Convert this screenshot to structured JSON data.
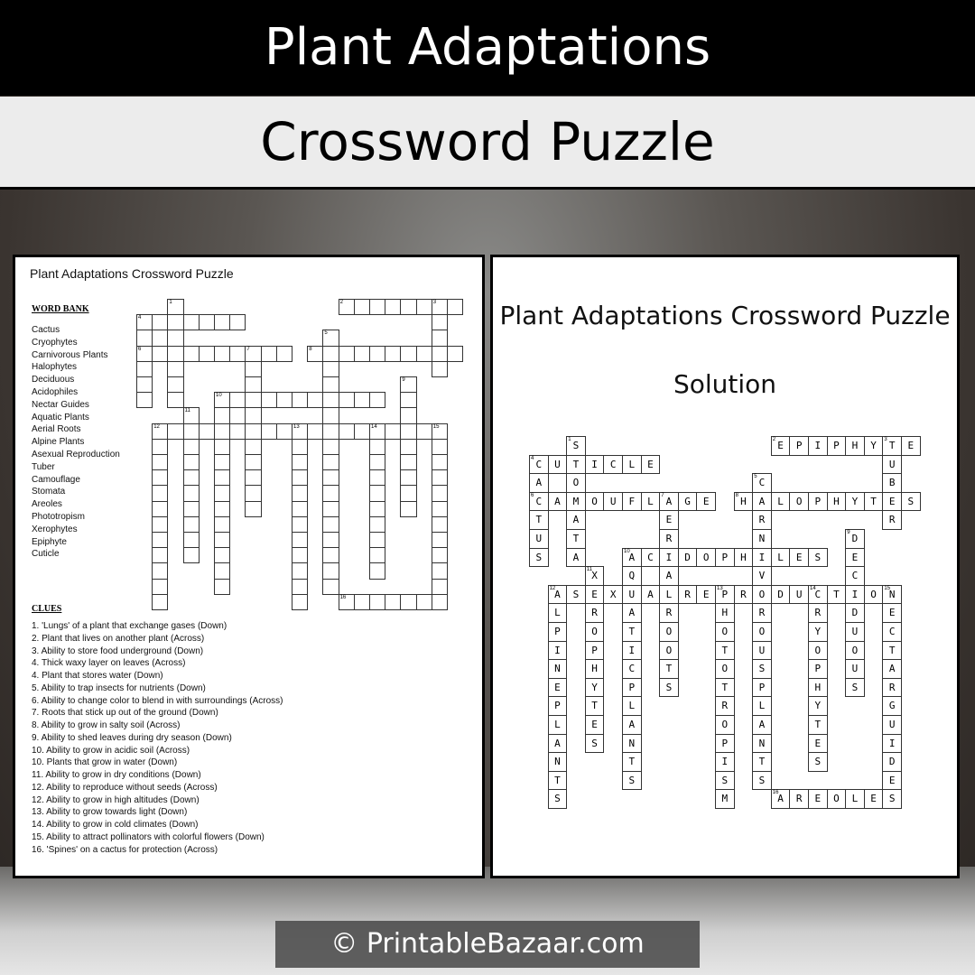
{
  "header": {
    "title": "Plant Adaptations",
    "subtitle": "Crossword Puzzle"
  },
  "worksheet": {
    "title": "Plant Adaptations Crossword Puzzle",
    "word_bank_title": "WORD BANK",
    "word_bank": [
      "Cactus",
      "Cryophytes",
      "Carnivorous Plants",
      "Halophytes",
      "Deciduous",
      "Acidophiles",
      "Nectar Guides",
      "Aquatic Plants",
      "Aerial Roots",
      "Alpine Plants",
      "Asexual Reproduction",
      "Tuber",
      "Camouflage",
      "Stomata",
      "Areoles",
      "Phototropism",
      "Xerophytes",
      "Epiphyte",
      "Cuticle"
    ],
    "clues_title": "CLUES",
    "clues": [
      "1. 'Lungs' of a plant that exchange gases (Down)",
      "2. Plant that lives on another plant (Across)",
      "3. Ability to store food underground  (Down)",
      "4. Thick waxy layer on leaves (Across)",
      "4. Plant that stores water (Down)",
      "5. Ability to trap insects for nutrients  (Down)",
      "6. Ability to change color to blend in with surroundings (Across)",
      "7. Roots that stick up out of the ground  (Down)",
      "8. Ability to grow in salty soil (Across)",
      "9. Ability to shed leaves during dry season (Down)",
      "10. Ability to grow in acidic soil (Across)",
      "10. Plants that grow in water  (Down)",
      "11. Ability to grow in dry conditions (Down)",
      "12. Ability to reproduce  without  seeds (Across)",
      "12. Ability to grow in high altitudes (Down)",
      "13. Ability to grow towards light (Down)",
      "14. Ability to grow in cold climates (Down)",
      "15. Ability to attract pollinators with colorful flowers (Down)",
      "16. 'Spines' on a cactus for protection (Across)"
    ]
  },
  "solution": {
    "title": "Plant Adaptations Crossword Puzzle",
    "subtitle": "Solution"
  },
  "crossword": {
    "words": [
      {
        "num": 1,
        "dir": "down",
        "row": 0,
        "col": 2,
        "answer": "STOMATA"
      },
      {
        "num": 2,
        "dir": "across",
        "row": 0,
        "col": 13,
        "answer": "EPIPHYTE"
      },
      {
        "num": 3,
        "dir": "down",
        "row": 0,
        "col": 19,
        "answer": "TUBER"
      },
      {
        "num": 4,
        "dir": "across",
        "row": 1,
        "col": 0,
        "answer": "CUTICLE"
      },
      {
        "num": 4,
        "dir": "down",
        "row": 1,
        "col": 0,
        "answer": "CACTUS"
      },
      {
        "num": 5,
        "dir": "down",
        "row": 2,
        "col": 12,
        "answer": "CARNIVOROUSPLANTS"
      },
      {
        "num": 6,
        "dir": "across",
        "row": 3,
        "col": 0,
        "answer": "CAMOUFLAGE"
      },
      {
        "num": 7,
        "dir": "down",
        "row": 3,
        "col": 7,
        "answer": "AERIALROOTS"
      },
      {
        "num": 8,
        "dir": "across",
        "row": 3,
        "col": 11,
        "answer": "HALOPHYTES"
      },
      {
        "num": 9,
        "dir": "down",
        "row": 5,
        "col": 17,
        "answer": "DECIDUOUS"
      },
      {
        "num": 10,
        "dir": "across",
        "row": 6,
        "col": 5,
        "answer": "ACIDOPHILES"
      },
      {
        "num": 10,
        "dir": "down",
        "row": 6,
        "col": 5,
        "answer": "AQUATICPLANTS"
      },
      {
        "num": 11,
        "dir": "down",
        "row": 7,
        "col": 3,
        "answer": "XEROPHYTES"
      },
      {
        "num": 12,
        "dir": "across",
        "row": 8,
        "col": 1,
        "answer": "ASEXUALREPRODUCTION"
      },
      {
        "num": 12,
        "dir": "down",
        "row": 8,
        "col": 1,
        "answer": "ALPINEPLANTS"
      },
      {
        "num": 13,
        "dir": "down",
        "row": 8,
        "col": 10,
        "answer": "PHOTOTROPISM"
      },
      {
        "num": 14,
        "dir": "down",
        "row": 8,
        "col": 15,
        "answer": "CRYOPHYTES"
      },
      {
        "num": 15,
        "dir": "down",
        "row": 8,
        "col": 19,
        "answer": "NECTARGUIDES"
      },
      {
        "num": 16,
        "dir": "across",
        "row": 19,
        "col": 13,
        "answer": "AREOLES"
      }
    ]
  },
  "footer": {
    "text": "© PrintableBazaar.com"
  }
}
